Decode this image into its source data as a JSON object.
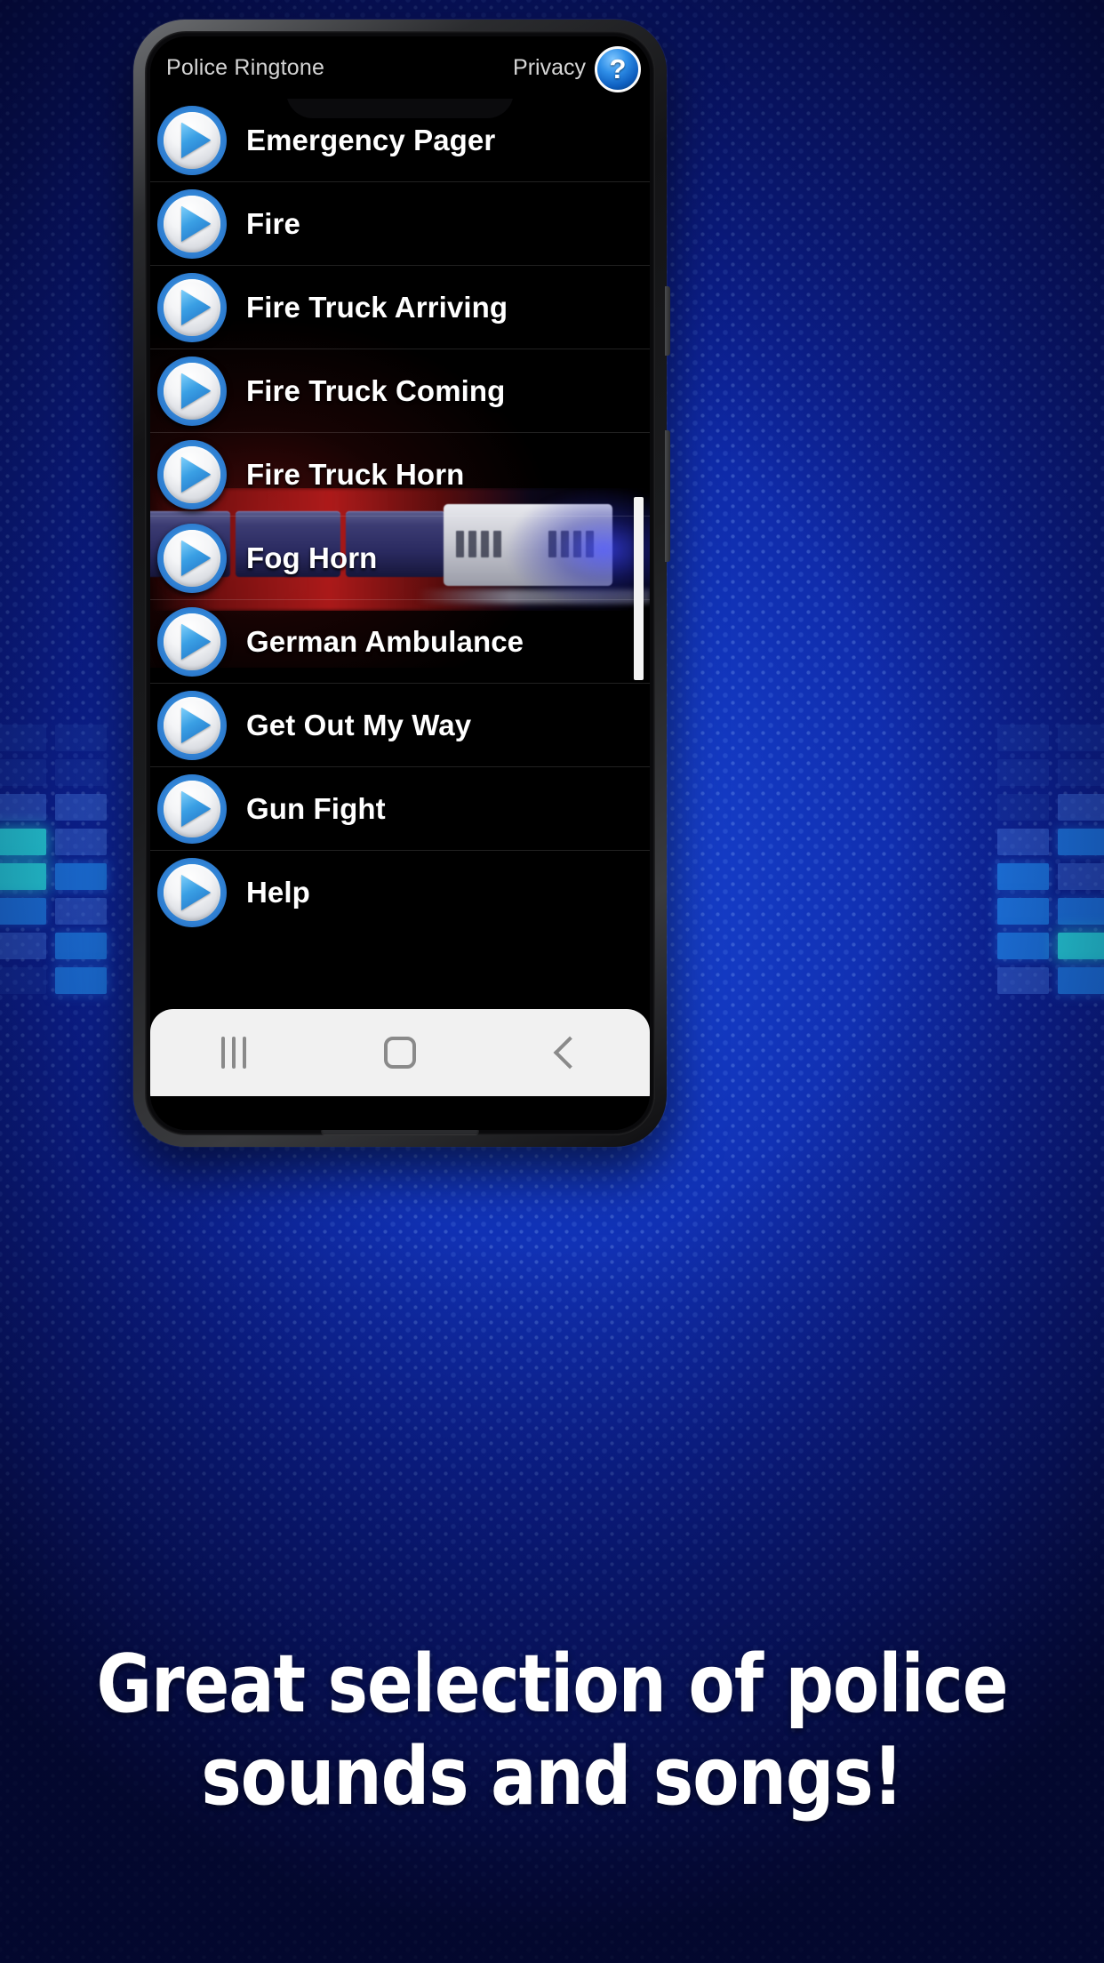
{
  "header": {
    "app_title": "Police Ringtone",
    "privacy_label": "Privacy",
    "help_icon_glyph": "?",
    "help_icon_name": "help-question-icon"
  },
  "list": {
    "items": [
      {
        "label": "Emergency Pager",
        "play_icon": "play-icon"
      },
      {
        "label": "Fire",
        "play_icon": "play-icon"
      },
      {
        "label": "Fire Truck Arriving",
        "play_icon": "play-icon"
      },
      {
        "label": "Fire Truck Coming",
        "play_icon": "play-icon"
      },
      {
        "label": "Fire Truck Horn",
        "play_icon": "play-icon"
      },
      {
        "label": "Fog Horn",
        "play_icon": "play-icon"
      },
      {
        "label": "German Ambulance",
        "play_icon": "play-icon"
      },
      {
        "label": "Get Out My Way",
        "play_icon": "play-icon"
      },
      {
        "label": "Gun Fight",
        "play_icon": "play-icon"
      },
      {
        "label": "Help",
        "play_icon": "play-icon"
      }
    ]
  },
  "nav_bar": {
    "recents_icon": "recents-icon",
    "home_icon": "home-icon",
    "back_icon": "back-icon"
  },
  "promo": {
    "line1": "Great selection of police",
    "line2": "sounds and songs!"
  },
  "colors": {
    "background_blue": "#1235bb",
    "accent_blue": "#2f8fe8",
    "equalizer_cyan": "#2ae7ef",
    "equalizer_blue": "#1f7ef0",
    "screen_black": "#000000",
    "nav_bar_gray": "#f1f1f1",
    "text_white": "#ffffff"
  }
}
